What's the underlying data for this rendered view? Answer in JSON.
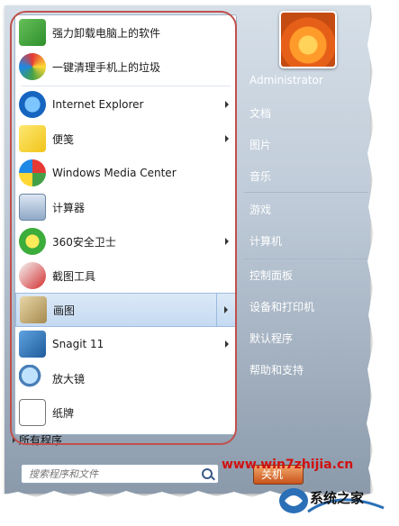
{
  "start_menu": {
    "pinned": [
      {
        "label": "强力卸载电脑上的软件",
        "icon": "uninstall-icon",
        "submenu": false
      },
      {
        "label": "一键清理手机上的垃圾",
        "icon": "cleaner-icon",
        "submenu": false
      }
    ],
    "recent": [
      {
        "label": "Internet Explorer",
        "icon": "internet-explorer-icon",
        "submenu": true
      },
      {
        "label": "便笺",
        "icon": "sticky-notes-icon",
        "submenu": true
      },
      {
        "label": "Windows Media Center",
        "icon": "windows-media-center-icon",
        "submenu": false
      },
      {
        "label": "计算器",
        "icon": "calculator-icon",
        "submenu": false
      },
      {
        "label": "360安全卫士",
        "icon": "360-security-icon",
        "submenu": true
      },
      {
        "label": "截图工具",
        "icon": "snipping-tool-icon",
        "submenu": false
      },
      {
        "label": "画图",
        "icon": "paint-icon",
        "submenu": true,
        "selected": true
      },
      {
        "label": "Snagit 11",
        "icon": "snagit-icon",
        "submenu": true
      },
      {
        "label": "放大镜",
        "icon": "magnifier-icon",
        "submenu": false
      },
      {
        "label": "纸牌",
        "icon": "solitaire-icon",
        "submenu": false
      }
    ],
    "all_programs": "所有程序",
    "search_placeholder": "搜索程序和文件",
    "right_pane": [
      {
        "label": "Administrator"
      },
      {
        "label": "文档"
      },
      {
        "label": "图片"
      },
      {
        "label": "音乐"
      },
      {
        "label": "游戏"
      },
      {
        "label": "计算机"
      },
      {
        "label": "控制面板"
      },
      {
        "label": "设备和打印机"
      },
      {
        "label": "默认程序"
      },
      {
        "label": "帮助和支持"
      }
    ],
    "shutdown_label": "关机"
  },
  "watermark": {
    "url": "www.win7zhijia.cn",
    "brand": "系统之家"
  },
  "colors": {
    "annotation_outline": "#c0504d",
    "selected_item": "#c4daf2"
  }
}
